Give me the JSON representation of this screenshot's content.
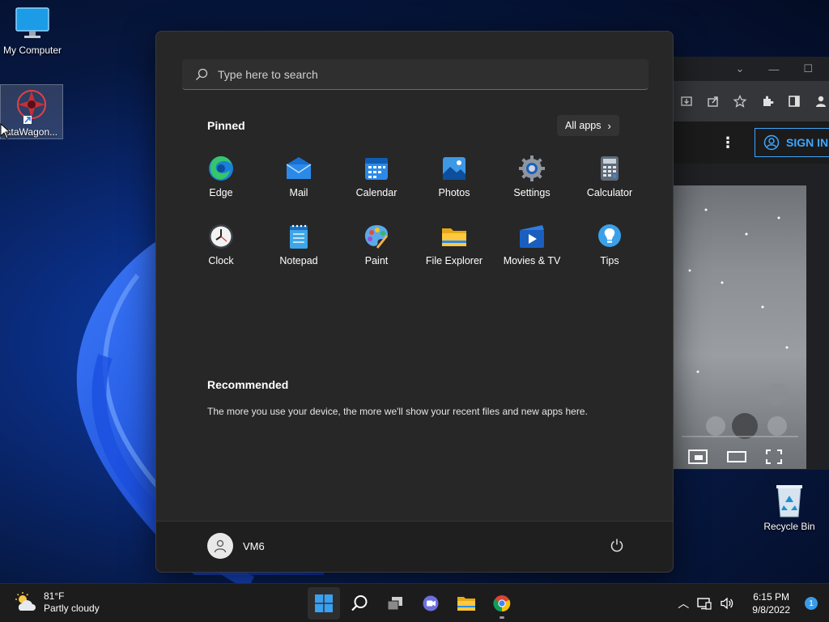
{
  "desktop": {
    "icons": [
      {
        "label": "My Computer"
      },
      {
        "label": "ataWagon..."
      }
    ],
    "recycle_bin": {
      "label": "Recycle Bin"
    }
  },
  "browser": {
    "sign_in_label": "SIGN IN"
  },
  "start_menu": {
    "search": {
      "placeholder": "Type here to search"
    },
    "pinned_title": "Pinned",
    "all_apps_label": "All apps",
    "pinned_apps": [
      {
        "name": "Edge",
        "icon": "edge-icon"
      },
      {
        "name": "Mail",
        "icon": "mail-icon"
      },
      {
        "name": "Calendar",
        "icon": "calendar-icon"
      },
      {
        "name": "Photos",
        "icon": "photos-icon"
      },
      {
        "name": "Settings",
        "icon": "settings-icon"
      },
      {
        "name": "Calculator",
        "icon": "calculator-icon"
      },
      {
        "name": "Clock",
        "icon": "clock-icon"
      },
      {
        "name": "Notepad",
        "icon": "notepad-icon"
      },
      {
        "name": "Paint",
        "icon": "paint-icon"
      },
      {
        "name": "File Explorer",
        "icon": "file-explorer-icon"
      },
      {
        "name": "Movies & TV",
        "icon": "movies-tv-icon"
      },
      {
        "name": "Tips",
        "icon": "tips-icon"
      }
    ],
    "recommended_title": "Recommended",
    "recommended_text": "The more you use your device, the more we'll show your recent files and new apps here.",
    "user_name": "VM6"
  },
  "taskbar": {
    "weather": {
      "temp": "81°F",
      "condition": "Partly cloudy"
    },
    "apps": [
      "start",
      "search",
      "task-view",
      "teams-chat",
      "file-explorer",
      "chrome"
    ],
    "time": "6:15 PM",
    "date": "9/8/2022",
    "notification_count": "1"
  },
  "colors": {
    "accent": "#3a9be8",
    "start_bg": "#272727",
    "taskbar_bg": "#1c1c1c"
  }
}
